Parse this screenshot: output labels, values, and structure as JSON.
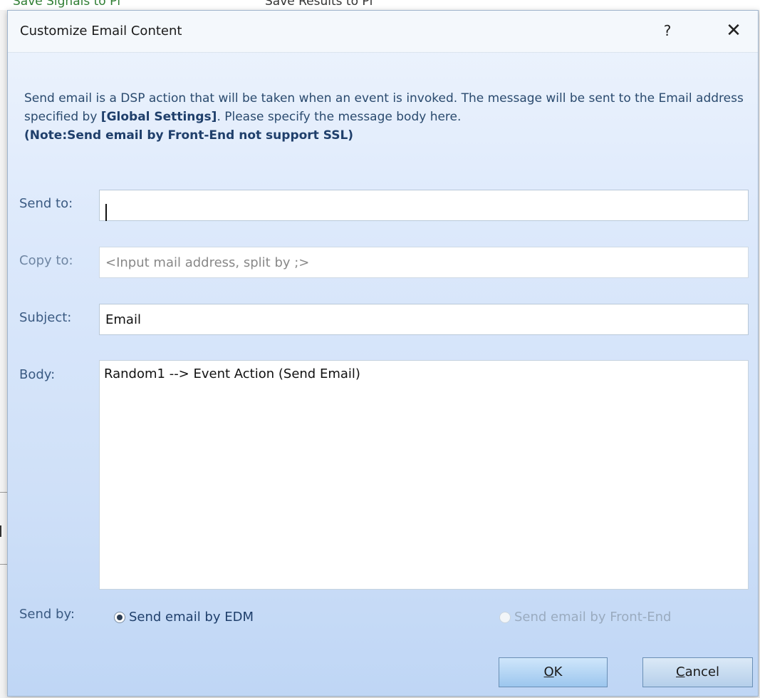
{
  "background": {
    "left_text": "Save Signals to Pl",
    "right_text": "Save Results to Pl"
  },
  "dialog": {
    "title": "Customize Email Content",
    "help_label": "?",
    "close_label": "✕",
    "description_part1": "Send email is a DSP action that will be taken when an event is invoked. The message will be sent to the Email address specified by ",
    "description_bold": "[Global Settings]",
    "description_part2": ". Please specify the message body here.",
    "note": "(Note:Send email by Front-End not support SSL)"
  },
  "form": {
    "send_to": {
      "label": "Send to:",
      "value": ""
    },
    "copy_to": {
      "label": "Copy to:",
      "placeholder": "<Input mail address, split by ;>"
    },
    "subject": {
      "label": "Subject:",
      "value": "Email"
    },
    "body": {
      "label": "Body:",
      "value": "Random1 --> Event Action (Send Email)"
    },
    "send_by": {
      "label": "Send by:",
      "option_edm": "Send email by EDM",
      "option_frontend": "Send email by Front-End",
      "selected": "Send email by EDM"
    }
  },
  "buttons": {
    "ok_accel": "O",
    "ok_rest": "K",
    "cancel_accel": "C",
    "cancel_rest": "ancel"
  },
  "colors": {
    "accent": "#1f3f6b",
    "label": "#3a5a82",
    "dialog_bg_top": "#eef4fd",
    "dialog_bg_bottom": "#bfd6f5"
  }
}
